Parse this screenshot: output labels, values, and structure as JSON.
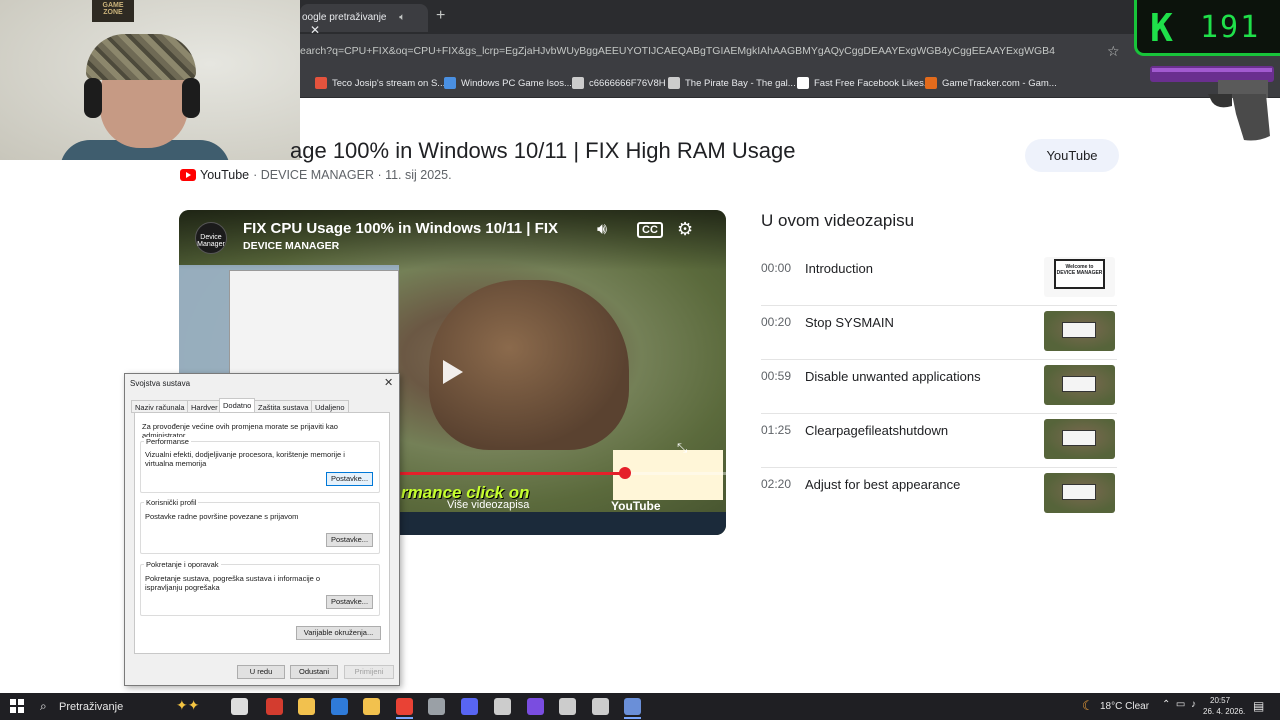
{
  "browser": {
    "tab_title": "Google pretraživanje",
    "tab_title_visible": "oogle pretraživanje",
    "url_visible": "earch?q=CPU+FIX&oq=CPU+FIX&gs_lcrp=EgZjaHJvbWUyBggAEEUYOTIJCAEQABgTGIAEMgkIAhAAGBMYgAQyCggDEAAYExgWGB4yCggEEAAYExgWGB4",
    "bookmarks": [
      {
        "label": "Teco Josip's stream on S...",
        "color": "#e5533d"
      },
      {
        "label": "Windows PC Game Isos...",
        "color": "#4a90e2"
      },
      {
        "label": "c6666666F76V8H",
        "color": "#cccccc"
      },
      {
        "label": "The Pirate Bay - The gal...",
        "color": "#cccccc"
      },
      {
        "label": "Fast Free Facebook Likes...",
        "color": "#ffffff"
      },
      {
        "label": "GameTracker.com - Gam...",
        "color": "#e36b1c"
      }
    ]
  },
  "overlay": {
    "poster_text": "GAME ZONE",
    "k_letter": "K",
    "k_score": "191"
  },
  "page": {
    "title_visible": "age 100% in Windows 10/11 | FIX High RAM Usage",
    "source": "YouTube",
    "meta_rest": "· DEVICE MANAGER · 11. sij 2025.",
    "youtube_button": "YouTube"
  },
  "video": {
    "title": "FIX CPU Usage 100% in Windows 10/11 | FIX",
    "channel": "DEVICE MANAGER",
    "logo_text": "Device Manager",
    "caption": "rmance click on",
    "more_videos": "Više videozapisa",
    "watermark": "YouTube",
    "progress": 0.69,
    "icons": [
      "volume-icon",
      "cc-icon",
      "settings-icon",
      "play-icon",
      "expand-icon"
    ]
  },
  "dialog": {
    "title": "Svojstva sustava",
    "tabs": [
      "Naziv računala",
      "Hardver",
      "Dodatno",
      "Zaštita sustava",
      "Udaljeno"
    ],
    "active_tab": "Dodatno",
    "admin_note": "Za provođenje većine ovih promjena morate se prijaviti kao administrator.",
    "performance": {
      "label": "Performanse",
      "desc": "Vizualni efekti, dodjeljivanje procesora, korištenje memorije i virtualna memorija",
      "button": "Postavke..."
    },
    "profile": {
      "label": "Korisnički profil",
      "desc": "Postavke radne površine povezane s prijavom",
      "button": "Postavke..."
    },
    "startup": {
      "label": "Pokretanje i oporavak",
      "desc": "Pokretanje sustava, pogreška sustava i informacije o ispravljanju pogrešaka",
      "button": "Postavke..."
    },
    "env_button": "Varijable okruženja...",
    "ok": "U redu",
    "cancel": "Odustani",
    "apply": "Primijeni"
  },
  "chapters": {
    "heading": "U ovom videozapisu",
    "items": [
      {
        "time": "00:00",
        "label": "Introduction",
        "thumb_text": "Welcome to DEVICE MANAGER"
      },
      {
        "time": "00:20",
        "label": "Stop SYSMAIN",
        "thumb_text": ""
      },
      {
        "time": "00:59",
        "label": "Disable unwanted applications",
        "thumb_text": ""
      },
      {
        "time": "01:25",
        "label": "Clearpagefileatshutdown",
        "thumb_text": ""
      },
      {
        "time": "02:20",
        "label": "Adjust for best appearance",
        "thumb_text": ""
      }
    ]
  },
  "taskbar": {
    "search_placeholder": "Pretraživanje",
    "weather": "18°C  Clear",
    "time": "20:57",
    "date": "26. 4. 2026.",
    "apps": [
      {
        "name": "task-view",
        "color": "#dddddd"
      },
      {
        "name": "chromium",
        "color": "#d33c2f"
      },
      {
        "name": "file-explorer",
        "color": "#f2c14e"
      },
      {
        "name": "mail",
        "color": "#2f7bd9"
      },
      {
        "name": "calendar",
        "color": "#f2c14e"
      },
      {
        "name": "chrome",
        "color": "#e94235"
      },
      {
        "name": "notepad",
        "color": "#9aa0a6"
      },
      {
        "name": "discord",
        "color": "#5865f2"
      },
      {
        "name": "game-booster",
        "color": "#cccccc"
      },
      {
        "name": "obs",
        "color": "#7a4de0"
      },
      {
        "name": "settings",
        "color": "#cccccc"
      },
      {
        "name": "settings-2",
        "color": "#cccccc"
      },
      {
        "name": "system-properties",
        "color": "#6a8fd8"
      }
    ]
  }
}
